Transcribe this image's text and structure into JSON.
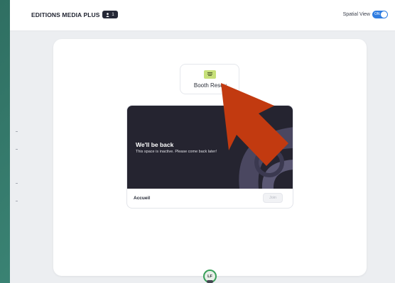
{
  "header": {
    "brand": "EDITIONS MEDIA PLUS",
    "user_count": "1",
    "spatial_view_label": "Spatial View",
    "toggle_label": "ON"
  },
  "booth": {
    "label": "Booth Resou"
  },
  "room": {
    "banner_title": "We'll be back",
    "banner_subtitle": "This space is inactive. Please come back later!",
    "name": "Accueil",
    "join_label": "Join"
  },
  "avatar": {
    "initials": "LF"
  },
  "icons": {
    "user": "user-icon",
    "booth": "booth-icon",
    "arrow": "pointer-arrow"
  },
  "colors": {
    "background": "#3d8878",
    "toggle": "#2f7de1",
    "booth_icon": "#c7e07a",
    "banner": "#252430",
    "arrow": "#c23a10",
    "avatar_ring": "#3aa05a"
  }
}
